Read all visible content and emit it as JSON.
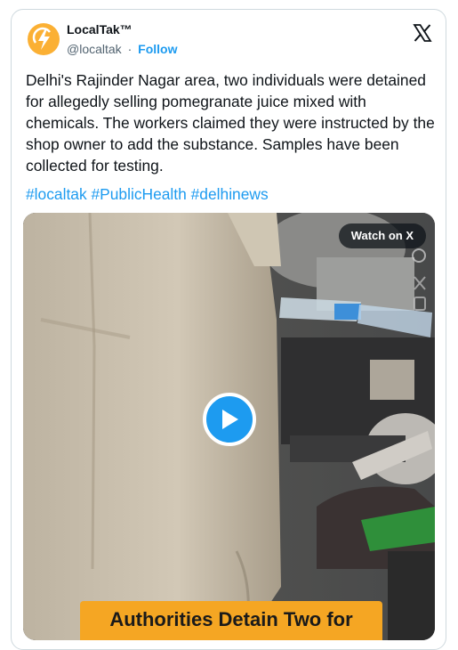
{
  "tweet": {
    "author_name": "LocalTak™",
    "handle": "@localtak",
    "separator": "·",
    "follow_label": "Follow",
    "text": "Delhi's Rajinder Nagar area, two individuals were detained for allegedly selling pomegranate juice mixed with chemicals. The workers claimed they were instructed by the shop owner to add the substance. Samples have been collected for testing.",
    "hashtags": [
      "#localtak",
      "#PublicHealth",
      "#delhinews"
    ]
  },
  "media": {
    "watch_label": "Watch on X",
    "caption": "Authorities Detain Two for"
  },
  "icons": {
    "avatar": "lightning-bolt-icon",
    "brand": "x-logo-icon",
    "play": "play-icon"
  },
  "colors": {
    "link": "#1d9bf0",
    "text": "#0f1419",
    "muted": "#536471",
    "avatar_bg": "#fbb034",
    "caption_bg": "#f5a623"
  }
}
